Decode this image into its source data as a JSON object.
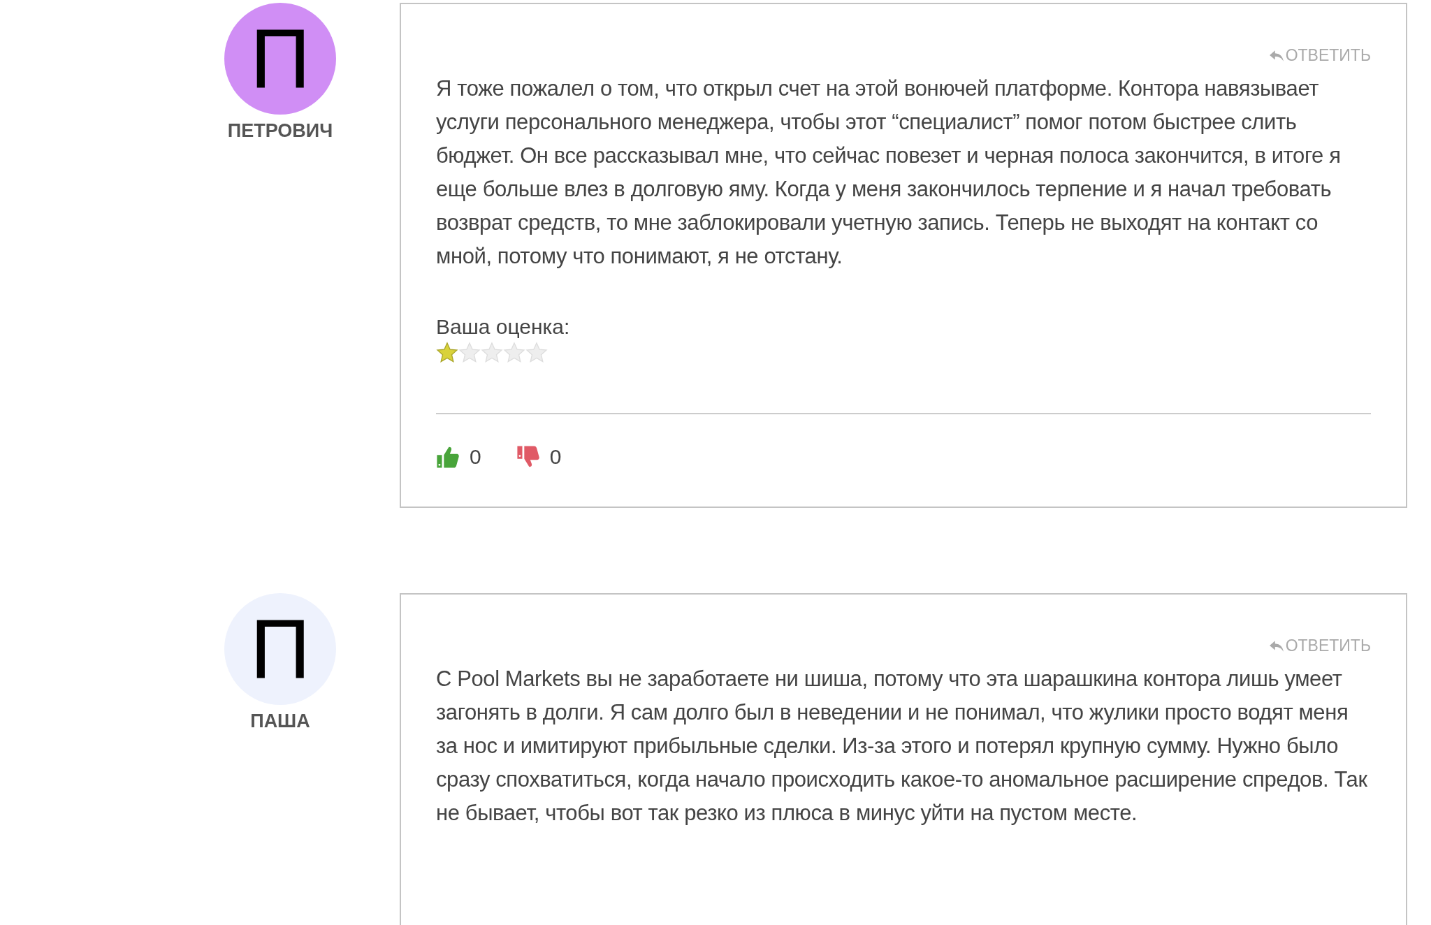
{
  "comments": [
    {
      "author": "ПЕТРОВИЧ",
      "avatar_letter": "П",
      "color": "#d08ef5",
      "reply": "ОТВЕТИТЬ",
      "text": "Я тоже пожалел о том, что открыл счет на этой вонючей платформе. Контора навязывает услуги персонального менеджера, чтобы этот “специалист” помог потом быстрее слить бюджет. Он все рассказывал мне, что сейчас повезет и черная полоса закончится, в итоге я еще больше влез в долговую яму. Когда у меня закончилось терпение и я начал требовать возврат средств, то мне заблокировали учетную запись. Теперь не выходят на контакт со мной, потому что понимают, я не отстану.",
      "rating_label": "Ваша оценка:",
      "stars": 1,
      "likes": "0",
      "dislikes": "0"
    },
    {
      "author": "ПАША",
      "avatar_letter": "П",
      "color": "#eef2fd",
      "reply": "ОТВЕТИТЬ",
      "text": "С Pool Markets вы не заработаете ни шиша, потому что эта шарашкина контора лишь умеет загонять в долги. Я сам долго был в неведении и не понимал, что жулики просто водят меня за нос и имитируют прибыльные сделки. Из-за этого и потерял крупную сумму. Нужно было сразу спохватиться, когда начало происходить какое-то аномальное расширение спредов. Так не бывает, чтобы вот так резко из плюса в минус уйти на пустом месте."
    }
  ]
}
